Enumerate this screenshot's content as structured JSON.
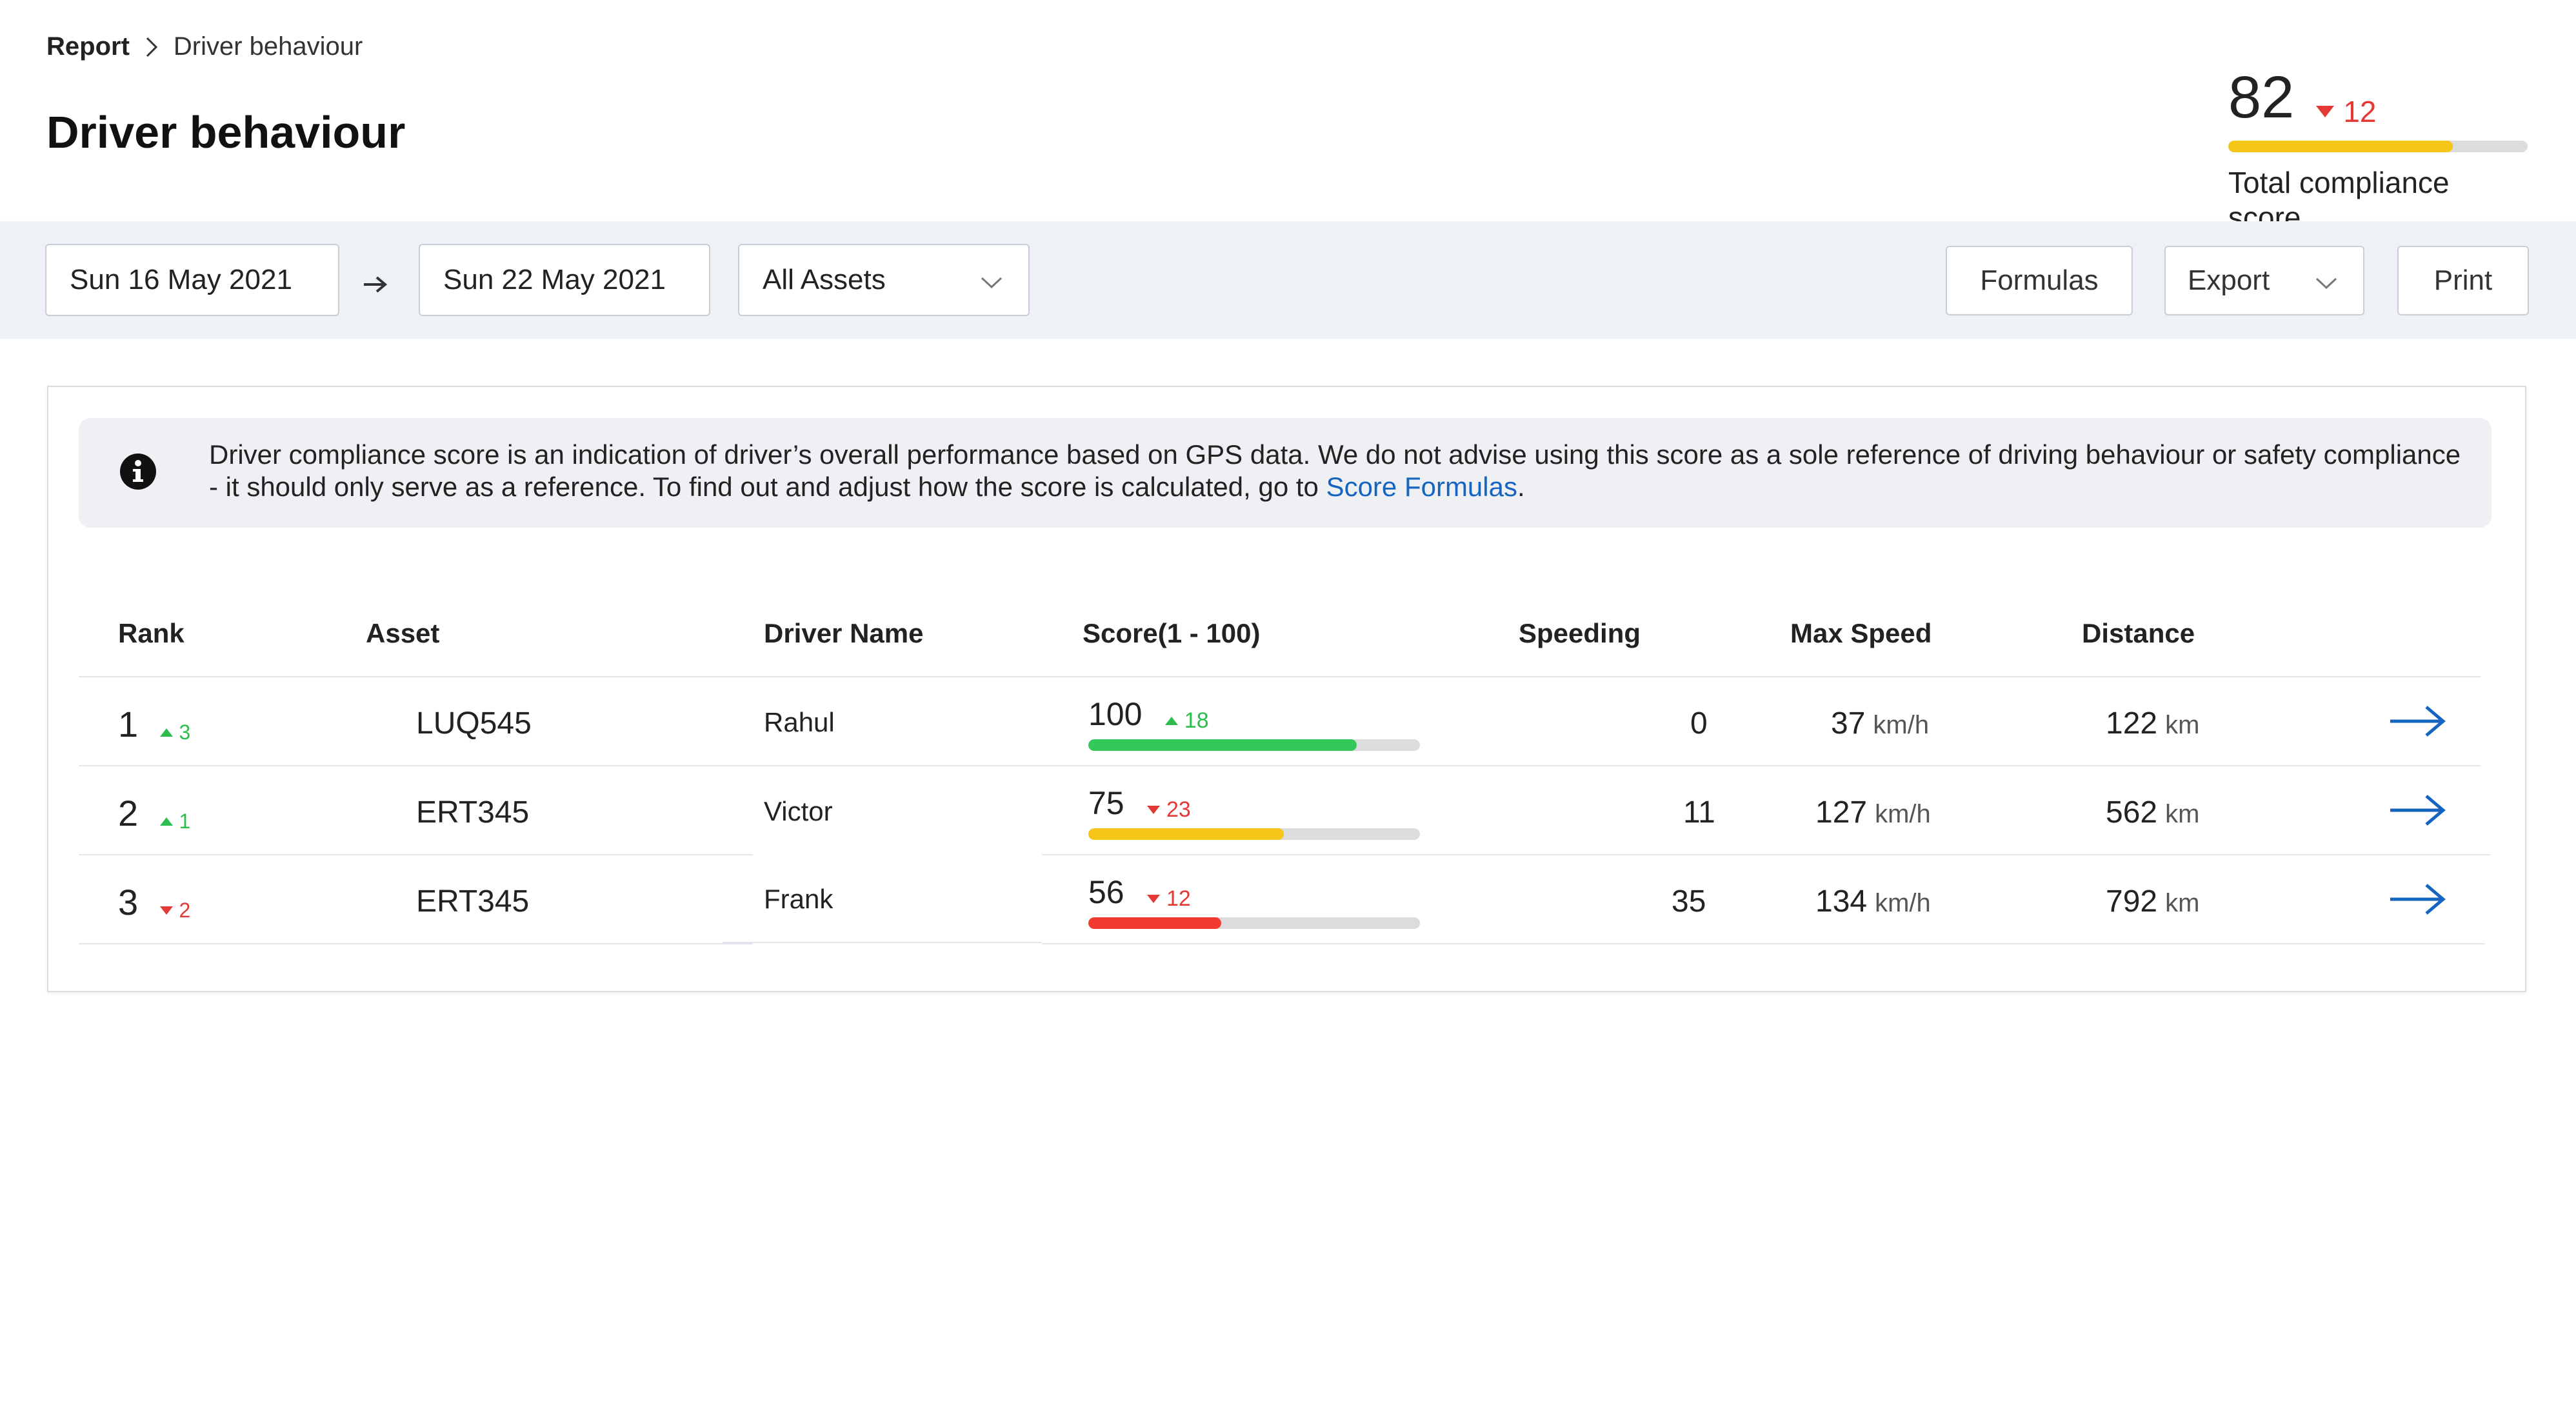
{
  "breadcrumb": {
    "root": "Report",
    "current": "Driver behaviour"
  },
  "page_title": "Driver behaviour",
  "compliance": {
    "score": "82",
    "delta": "12",
    "delta_direction": "down",
    "progress_percent": 75,
    "caption": "Total compliance score",
    "bar_color": "#f5c518"
  },
  "filters": {
    "start_date": "Sun 16 May 2021",
    "end_date": "Sun 22 May 2021",
    "assets": "All Assets"
  },
  "actions": {
    "formulas": "Formulas",
    "export": "Export",
    "print": "Print"
  },
  "notice": {
    "text": "Driver compliance score is an indication of driver’s overall performance based on GPS data. We do not advise using this score as a sole reference of driving behaviour or safety compliance - it should only serve as a reference. To find out and adjust how the score is calculated, go to ",
    "link": "Score Formulas",
    "end": "."
  },
  "table": {
    "columns": [
      "Rank",
      "Asset",
      "Driver Name",
      "Score(1 - 100)",
      "Speeding",
      "Max Speed",
      "Distance"
    ],
    "speed_unit": "km/h",
    "distance_unit": "km",
    "rows": [
      {
        "rank": "1",
        "rank_delta": "3",
        "rank_dir": "up",
        "asset": "LUQ545",
        "driver": "Rahul",
        "score": "100",
        "score_delta": "18",
        "score_dir": "up",
        "score_progress_percent": 81,
        "score_color": "#34c759",
        "speeding": "0",
        "max_speed": "37",
        "distance": "122"
      },
      {
        "rank": "2",
        "rank_delta": "1",
        "rank_dir": "up",
        "asset": "ERT345",
        "driver": "Victor",
        "score": "75",
        "score_delta": "23",
        "score_dir": "down",
        "score_progress_percent": 59,
        "score_color": "#f5c518",
        "speeding": "11",
        "max_speed": "127",
        "distance": "562"
      },
      {
        "rank": "3",
        "rank_delta": "2",
        "rank_dir": "down",
        "asset": "ERT345",
        "driver": "Frank",
        "score": "56",
        "score_delta": "12",
        "score_dir": "down",
        "score_progress_percent": 40,
        "score_color": "#f23b30",
        "speeding": "35",
        "max_speed": "134",
        "distance": "792"
      }
    ]
  },
  "icons": {
    "breadcrumb_separator": "chevron-right-icon",
    "date_range": "arrow-right-icon",
    "dropdown": "chevron-down-icon",
    "info": "info-icon",
    "row_action": "arrow-right-icon"
  },
  "colors": {
    "accent": "#1565c0",
    "positive": "#2dbd4f",
    "negative": "#e53935"
  }
}
